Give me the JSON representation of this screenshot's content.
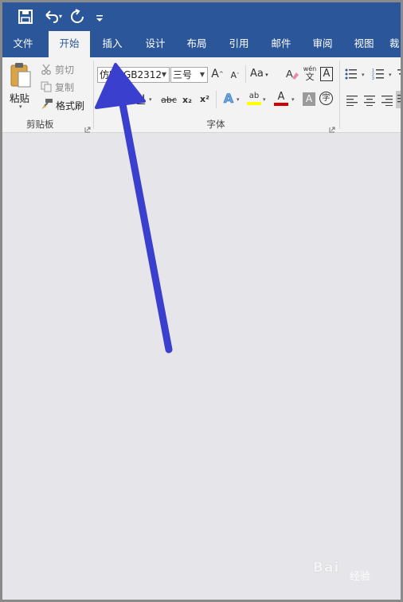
{
  "quick_access": {
    "icons": [
      "save-icon",
      "undo-icon",
      "redo-icon",
      "customize-icon"
    ],
    "accent": "#2b579a"
  },
  "tabs": [
    {
      "label": "文件",
      "active": false
    },
    {
      "label": "开始",
      "active": true
    },
    {
      "label": "插入",
      "active": false
    },
    {
      "label": "设计",
      "active": false
    },
    {
      "label": "布局",
      "active": false
    },
    {
      "label": "引用",
      "active": false
    },
    {
      "label": "邮件",
      "active": false
    },
    {
      "label": "审阅",
      "active": false
    },
    {
      "label": "视图",
      "active": false
    },
    {
      "label": "裁",
      "active": false
    }
  ],
  "clipboard": {
    "paste_label": "粘贴",
    "cut_label": "剪切",
    "copy_label": "复制",
    "format_painter_label": "格式刷",
    "group_label": "剪贴板"
  },
  "font": {
    "font_name": "仿宋_GB2312",
    "font_size": "三号",
    "grow_label": "A",
    "shrink_label": "A",
    "change_case_label": "Aa",
    "phonetic_top": "wén",
    "phonetic_bottom": "文",
    "char_border_label": "A",
    "bold_label": "B",
    "italic_label": "I",
    "underline_label": "U",
    "strike_label": "abc",
    "subscript_label": "x₂",
    "superscript_label": "x²",
    "text_effect_label": "A",
    "highlight_label": "ab",
    "font_color_label": "A",
    "char_shading_label": "A",
    "enclose_label": "字",
    "group_label": "字体",
    "font_color": "#d00000",
    "highlight_color": "#ffff00"
  },
  "annotation": {
    "arrow_color": "#3b3fce"
  },
  "watermark": {
    "text": "Bai",
    "sub": "经验"
  }
}
